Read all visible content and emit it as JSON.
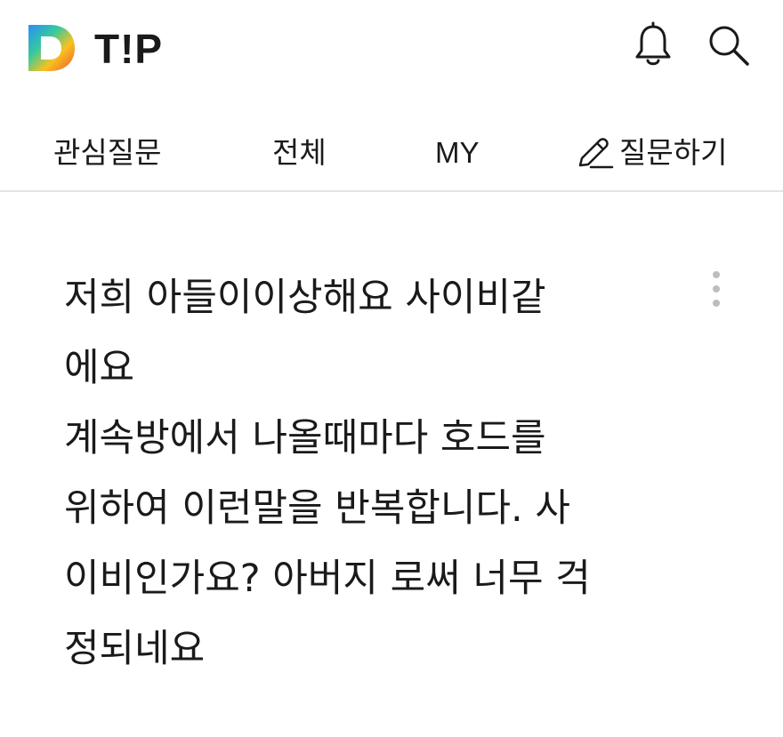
{
  "header": {
    "logo_letter": "D",
    "brand": "T!P",
    "icons": [
      "bell-icon",
      "search-icon"
    ]
  },
  "tabs": [
    {
      "label": "관심질문"
    },
    {
      "label": "전체"
    },
    {
      "label": "MY"
    },
    {
      "label": "질문하기",
      "icon": "pencil-icon"
    }
  ],
  "question": {
    "text": "저희 아들이이상해요 사이비같\n에요\n계속방에서 나올때마다 호드를\n위하여 이런말을 반복합니다. 사\n이비인가요? 아버지 로써 너무 걱\n정되네요",
    "more_icon": "more-vertical-icon"
  },
  "colors": {
    "logo_gradient": [
      "#2b8ef7",
      "#35c9a0",
      "#f7c21f",
      "#f2542d"
    ],
    "text": "#1a1a1a",
    "divider": "#e4e4e4",
    "more_dots": "#bdbdbd"
  }
}
